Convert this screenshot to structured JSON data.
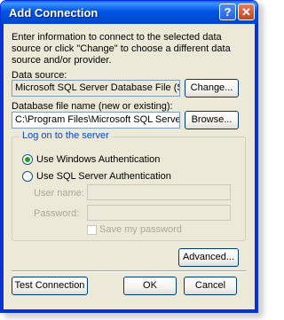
{
  "window": {
    "title": "Add Connection",
    "help_icon": "question-mark-icon",
    "close_icon": "close-x-icon"
  },
  "intro_text": "Enter information to connect to the selected data source or click \"Change\" to choose a different data source and/or provider.",
  "data_source": {
    "label": "Data source:",
    "value": "Microsoft SQL Server Database File (SqlClient)",
    "change_button": "Change..."
  },
  "database_file": {
    "label": "Database file name (new or existing):",
    "value": "C:\\Program Files\\Microsoft SQL Server\\MSSQL",
    "browse_button": "Browse..."
  },
  "logon": {
    "legend": "Log on to the server",
    "windows_auth": "Use Windows Authentication",
    "windows_auth_selected": true,
    "sql_auth": "Use SQL Server Authentication",
    "user_name_label": "User name:",
    "password_label": "Password:",
    "save_password": "Save my password"
  },
  "buttons": {
    "advanced": "Advanced...",
    "test_connection": "Test Connection",
    "ok": "OK",
    "cancel": "Cancel"
  },
  "colors": {
    "titlebar": "#0054e3",
    "dialog_bg": "#ece9d8",
    "group_legend": "#0046d5",
    "radio_dot": "#21a121"
  }
}
